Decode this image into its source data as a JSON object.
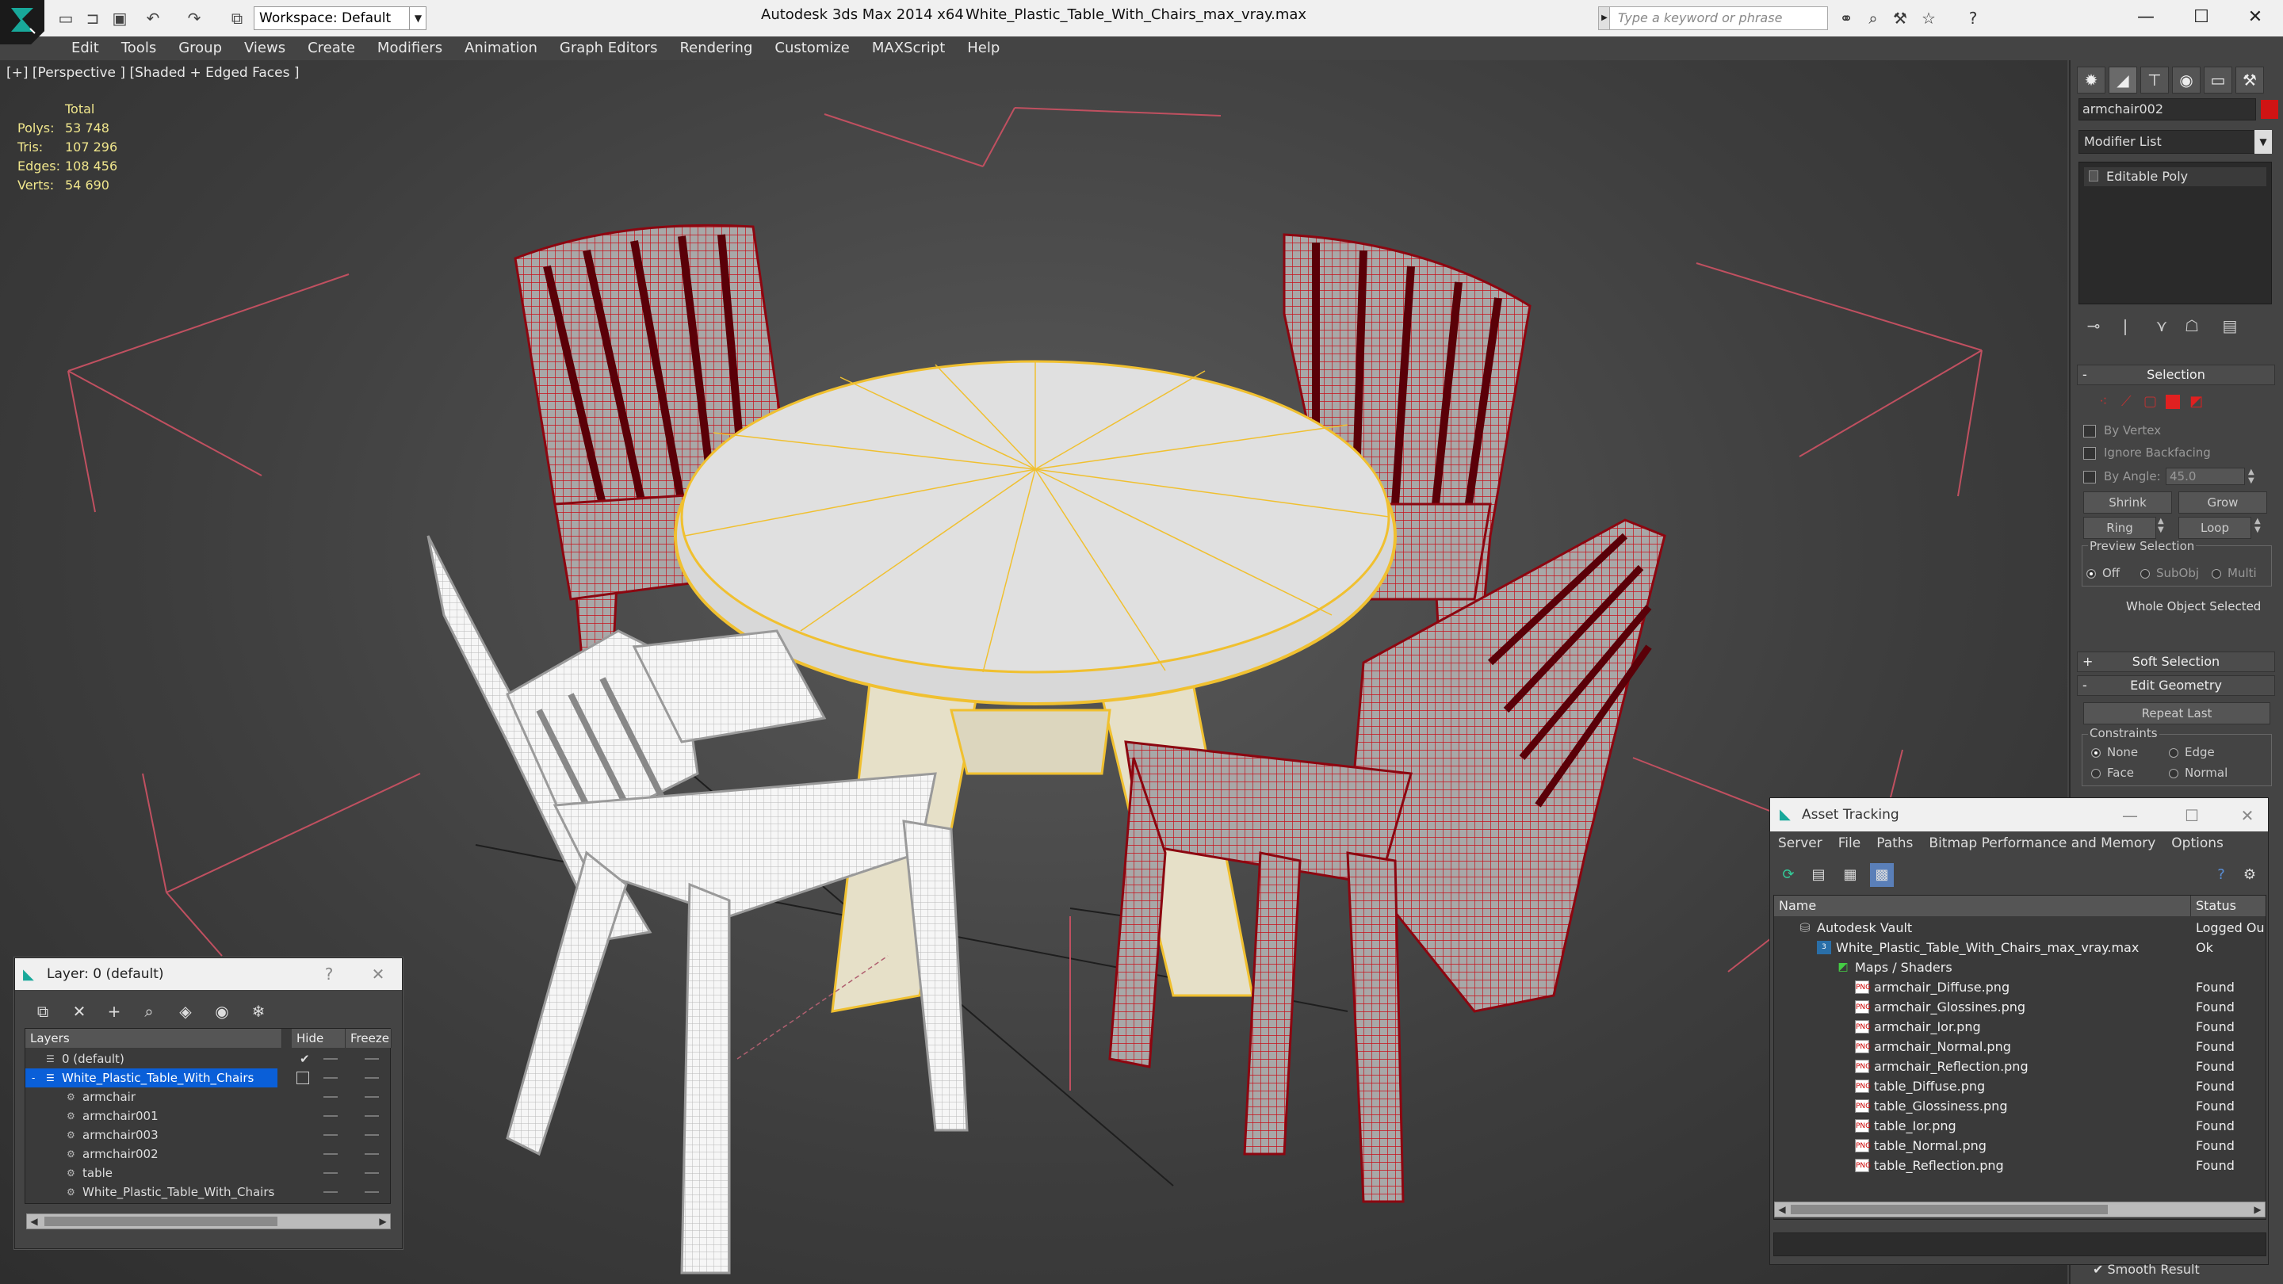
{
  "window": {
    "title": "Autodesk 3ds Max 2014 x64",
    "filename": "White_Plastic_Table_With_Chairs_max_vray.max",
    "workspace": "Workspace: Default",
    "search_placeholder": "Type a keyword or phrase"
  },
  "menu": [
    "Edit",
    "Tools",
    "Group",
    "Views",
    "Create",
    "Modifiers",
    "Animation",
    "Graph Editors",
    "Rendering",
    "Customize",
    "MAXScript",
    "Help"
  ],
  "viewport": {
    "label": "[+] [Perspective ] [Shaded + Edged Faces ]",
    "stats": {
      "header": "Total",
      "rows": [
        {
          "k": "Polys:",
          "v": "53 748"
        },
        {
          "k": "Tris:",
          "v": "107 296"
        },
        {
          "k": "Edges:",
          "v": "108 456"
        },
        {
          "k": "Verts:",
          "v": "54 690"
        }
      ]
    }
  },
  "command_panel": {
    "object_name": "armchair002",
    "object_color": "#d01414",
    "modifier_list": "Modifier List",
    "stack_item": "Editable Poly",
    "selection": {
      "title": "Selection",
      "by_vertex": "By Vertex",
      "ignore_backfacing": "Ignore Backfacing",
      "by_angle": "By Angle:",
      "angle_value": "45.0",
      "shrink": "Shrink",
      "grow": "Grow",
      "ring": "Ring",
      "loop": "Loop",
      "preview_title": "Preview Selection",
      "preview_off": "Off",
      "preview_subobj": "SubObj",
      "preview_multi": "Multi",
      "status": "Whole Object Selected"
    },
    "soft_selection": "Soft Selection",
    "edit_geometry": "Edit Geometry",
    "repeat_last": "Repeat Last",
    "constraints": {
      "title": "Constraints",
      "none": "None",
      "edge": "Edge",
      "face": "Face",
      "normal": "Normal"
    },
    "smooth_result": "Smooth Result"
  },
  "layer_dialog": {
    "title": "Layer: 0 (default)",
    "col_layers": "Layers",
    "col_hide": "Hide",
    "col_freeze": "Freeze",
    "rows": [
      {
        "name": "0 (default)",
        "indent": 0
      },
      {
        "name": "White_Plastic_Table_With_Chairs",
        "indent": 0
      },
      {
        "name": "armchair",
        "indent": 1
      },
      {
        "name": "armchair001",
        "indent": 1
      },
      {
        "name": "armchair003",
        "indent": 1
      },
      {
        "name": "armchair002",
        "indent": 1
      },
      {
        "name": "table",
        "indent": 1
      },
      {
        "name": "White_Plastic_Table_With_Chairs",
        "indent": 1
      }
    ]
  },
  "asset_tracking": {
    "title": "Asset Tracking",
    "menu": [
      "Server",
      "File",
      "Paths",
      "Bitmap Performance and Memory",
      "Options"
    ],
    "col_name": "Name",
    "col_status": "Status",
    "rows": [
      {
        "name": "Autodesk Vault",
        "status": "Logged Ou",
        "level": 0,
        "icon": "vault"
      },
      {
        "name": "White_Plastic_Table_With_Chairs_max_vray.max",
        "status": "Ok",
        "level": 1,
        "icon": "max"
      },
      {
        "name": "Maps / Shaders",
        "status": "",
        "level": 2,
        "icon": "maps"
      },
      {
        "name": "armchair_Diffuse.png",
        "status": "Found",
        "level": 3,
        "icon": "png"
      },
      {
        "name": "armchair_Glossines.png",
        "status": "Found",
        "level": 3,
        "icon": "png"
      },
      {
        "name": "armchair_Ior.png",
        "status": "Found",
        "level": 3,
        "icon": "png"
      },
      {
        "name": "armchair_Normal.png",
        "status": "Found",
        "level": 3,
        "icon": "png"
      },
      {
        "name": "armchair_Reflection.png",
        "status": "Found",
        "level": 3,
        "icon": "png"
      },
      {
        "name": "table_Diffuse.png",
        "status": "Found",
        "level": 3,
        "icon": "png"
      },
      {
        "name": "table_Glossiness.png",
        "status": "Found",
        "level": 3,
        "icon": "png"
      },
      {
        "name": "table_Ior.png",
        "status": "Found",
        "level": 3,
        "icon": "png"
      },
      {
        "name": "table_Normal.png",
        "status": "Found",
        "level": 3,
        "icon": "png"
      },
      {
        "name": "table_Reflection.png",
        "status": "Found",
        "level": 3,
        "icon": "png"
      }
    ]
  },
  "colors": {
    "selected_wire": "#c8101a",
    "table_wire": "#f0c030",
    "white_chair": "#f4f4f4",
    "selection_blue": "#0a5fd8"
  }
}
